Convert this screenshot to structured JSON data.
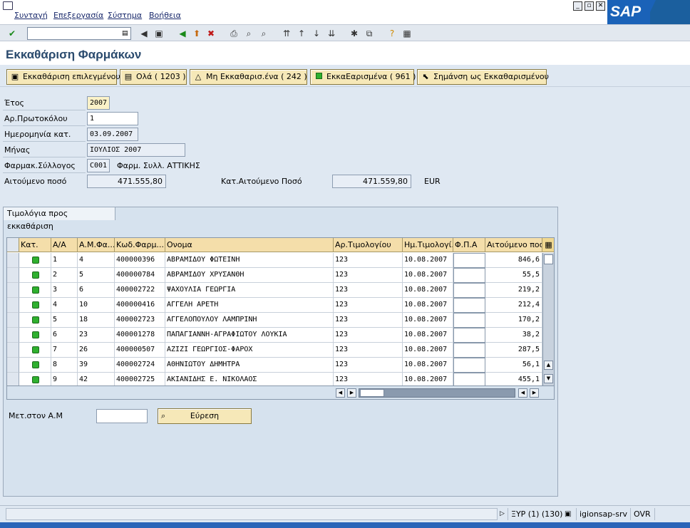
{
  "menu": [
    "Συνταγή",
    "Επεξεργασία",
    "Σύστημα",
    "Βοήθεια"
  ],
  "logo": "SAP",
  "command_field": {
    "value": ""
  },
  "title": "Εκκαθάριση Φαρμάκων",
  "app_toolbar": [
    {
      "label": "Εκκαθάριση επιλεγμένου",
      "icon": "clear-icon"
    },
    {
      "label": "Ολά ( 1203 )",
      "icon": "list-icon"
    },
    {
      "label": "Μη Εκκαθαρισ.ένα ( 242 )",
      "icon": "warning-triangle-icon"
    },
    {
      "label": "ΕκκαΕαρισμένα ( 961 )",
      "icon": "green-light-icon"
    },
    {
      "label": "Σημάνση ως Εκκαθαρισμένου",
      "icon": "mark-icon"
    }
  ],
  "form": {
    "year_label": "Έτος",
    "year_value": "2007",
    "protocol_label": "Αρ.Πρωτοκόλου",
    "protocol_value": "1",
    "date_label": "Ημερομηνία κατ.",
    "date_value": "03.09.2007",
    "month_label": "Μήνας",
    "month_value": "ΙΟΥΛΙΟΣ 2007",
    "assoc_label": "Φαρμακ.Σύλλογος",
    "assoc_code": "C001",
    "assoc_name": "Φαρμ. Συλλ. ΑΤΤΙΚΗΣ",
    "requested_label": "Αιτούμενο ποσό",
    "requested_value": "471.555,80",
    "cleared_label": "Κατ.Αιτούμενο Ποσό",
    "cleared_value": "471.559,80",
    "currency": "EUR"
  },
  "group_title": "Τιμολόγια προς εκκαθάριση",
  "table": {
    "columns": [
      "Κατ.",
      "Α/Α",
      "Α.Μ.Φα...",
      "Κωδ.Φαρμ...",
      "Ονομα",
      "Αρ.Τιμολογίου",
      "Ημ.Τιμολογί...",
      "Φ.Π.Α",
      "Αιτούμενο ποσ"
    ],
    "rows": [
      {
        "aa": "1",
        "am": "4",
        "code": "400000396",
        "name": "ΑΒΡΑΜΙΔΟΥ ΦΩΤΕΙΝΗ",
        "inv": "123",
        "date": "10.08.2007",
        "fpa": "",
        "amount": "846,6"
      },
      {
        "aa": "2",
        "am": "5",
        "code": "400000784",
        "name": "ΑΒΡΑΜΙΔΟΥ ΧΡΥΣΑΝΘΗ",
        "inv": "123",
        "date": "10.08.2007",
        "fpa": "",
        "amount": "55,5"
      },
      {
        "aa": "3",
        "am": "6",
        "code": "400002722",
        "name": "ΨΑΧΟΥΛΙΑ ΓΕΩΡΓΙΑ",
        "inv": "123",
        "date": "10.08.2007",
        "fpa": "",
        "amount": "219,2"
      },
      {
        "aa": "4",
        "am": "10",
        "code": "400000416",
        "name": "ΑΓΓΕΛΗ ΑΡΕΤΗ",
        "inv": "123",
        "date": "10.08.2007",
        "fpa": "",
        "amount": "212,4"
      },
      {
        "aa": "5",
        "am": "18",
        "code": "400002723",
        "name": "ΑΓΓΕΛΟΠΟΥΛΟΥ ΛΑΜΠΡΙΝΗ",
        "inv": "123",
        "date": "10.08.2007",
        "fpa": "",
        "amount": "170,2"
      },
      {
        "aa": "6",
        "am": "23",
        "code": "400001278",
        "name": "ΠΑΠΑΓΙΑΝΝΗ-ΑΓΡΑΦΙΩΤΟΥ ΛΟΥΚΙΑ",
        "inv": "123",
        "date": "10.08.2007",
        "fpa": "",
        "amount": "38,2"
      },
      {
        "aa": "7",
        "am": "26",
        "code": "400000507",
        "name": "ΑΖΙΖΙ ΓΕΩΡΓΙΟΣ-ΦΑΡΟΧ",
        "inv": "123",
        "date": "10.08.2007",
        "fpa": "",
        "amount": "287,5"
      },
      {
        "aa": "8",
        "am": "39",
        "code": "400002724",
        "name": "ΑΘΗΝΙΩΤΟΥ ΔΗΜΗΤΡΑ",
        "inv": "123",
        "date": "10.08.2007",
        "fpa": "",
        "amount": "56,1"
      },
      {
        "aa": "9",
        "am": "42",
        "code": "400002725",
        "name": "ΑΚΙΑΝΙΔΗΣ Ε. ΝΙΚΟΛΑΟΣ",
        "inv": "123",
        "date": "10.08.2007",
        "fpa": "",
        "amount": "455,1"
      }
    ]
  },
  "search": {
    "label": "Μετ.στον Α.Μ",
    "value": "",
    "button": "Εύρεση"
  },
  "status": {
    "system": "ΞΥΡ (1) (130)",
    "server": "igionsap-srv",
    "mode": "OVR"
  }
}
